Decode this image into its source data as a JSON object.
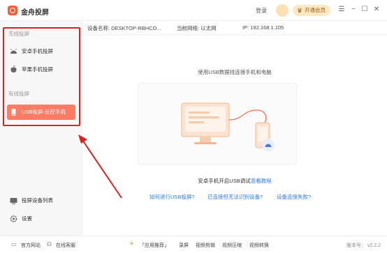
{
  "titlebar": {
    "app_title": "金舟投屏",
    "login": "登录",
    "vip_label": "开通会员",
    "menu_glyph": "☰",
    "min_glyph": "−",
    "max_glyph": "☐",
    "close_glyph": "✕"
  },
  "sidebar": {
    "wireless_heading": "无线投屏",
    "wired_heading": "有线投屏",
    "items": [
      {
        "label": "安卓手机投屏",
        "icon": "android-icon"
      },
      {
        "label": "苹果手机投屏",
        "icon": "apple-icon"
      },
      {
        "label": "USB投屏-反控手机",
        "icon": "usb-phone-icon"
      },
      {
        "label": "投屏设备列表",
        "icon": "device-list-icon"
      },
      {
        "label": "设置",
        "icon": "settings-icon"
      }
    ]
  },
  "infobar": {
    "device_name": "设备名称: DESKTOP-RBHCO...",
    "network": "当前网络: 以太网",
    "ip": "IP: 192.168.1.105"
  },
  "main": {
    "title": "使用USB数据线连接手机和电脑",
    "tutorial_prefix": "安卓手机开启USB调试",
    "tutorial_link": "查看教程",
    "help_links": [
      "如何进行USB投屏?",
      "已连接但无法识别设备?",
      "设备连接失败?"
    ]
  },
  "footer": {
    "website": "官方网站",
    "support": "在线客服",
    "app_recommend": "「应用推荐」",
    "tools": [
      "录屏",
      "视频剪辑",
      "视频压缩",
      "视频转换"
    ],
    "version": "版本号： v2.2.2"
  },
  "colors": {
    "accent": "#ff7b63",
    "link": "#2f7cf6",
    "annotation": "#e02020"
  }
}
